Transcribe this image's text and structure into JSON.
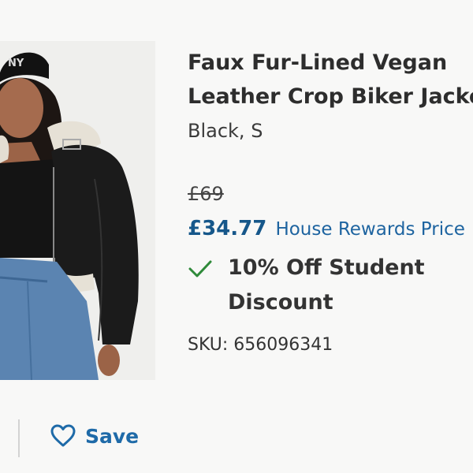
{
  "product": {
    "title_line1": "Faux Fur-Lined Vegan",
    "title_line2": "Leather Crop Biker Jacket",
    "variant": "Black, S",
    "image_alt": "Model wearing black faux fur-lined vegan leather crop biker jacket"
  },
  "pricing": {
    "was_price": "£69",
    "sale_price": "£34.77",
    "sale_label": "House Rewards Price"
  },
  "promotion": {
    "text": "10% Off Student Discount",
    "icon": "check-icon"
  },
  "sku": {
    "text": "SKU: 656096341"
  },
  "actions": {
    "save_label": "Save",
    "save_icon": "heart-icon"
  },
  "colors": {
    "accent": "#1e6aa8",
    "check": "#2f8a3a",
    "background": "#f8f8f7"
  }
}
